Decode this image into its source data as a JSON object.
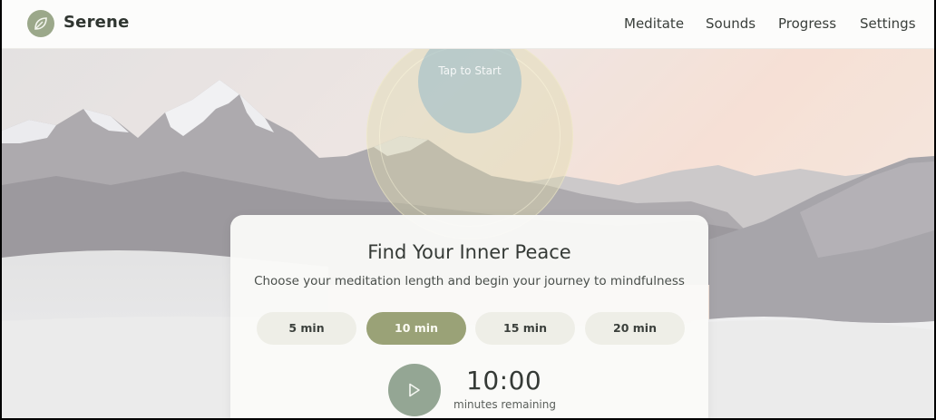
{
  "brand": {
    "name": "Serene",
    "logo_icon": "leaf-icon"
  },
  "nav": {
    "items": [
      {
        "label": "Meditate"
      },
      {
        "label": "Sounds"
      },
      {
        "label": "Progress"
      },
      {
        "label": "Settings"
      }
    ]
  },
  "breath": {
    "label": "Tap to Start"
  },
  "session": {
    "title": "Find Your Inner Peace",
    "subtitle": "Choose your meditation length and begin your journey to mindfulness",
    "durations": [
      {
        "label": "5 min",
        "selected": false
      },
      {
        "label": "10 min",
        "selected": true
      },
      {
        "label": "15 min",
        "selected": false
      },
      {
        "label": "20 min",
        "selected": false
      }
    ],
    "play_icon": "play-icon",
    "timer": "10:00",
    "timer_label": "minutes remaining"
  },
  "colors": {
    "accent": "#9aa277",
    "play_button": "#94a694",
    "logo": "#9ba88a"
  }
}
